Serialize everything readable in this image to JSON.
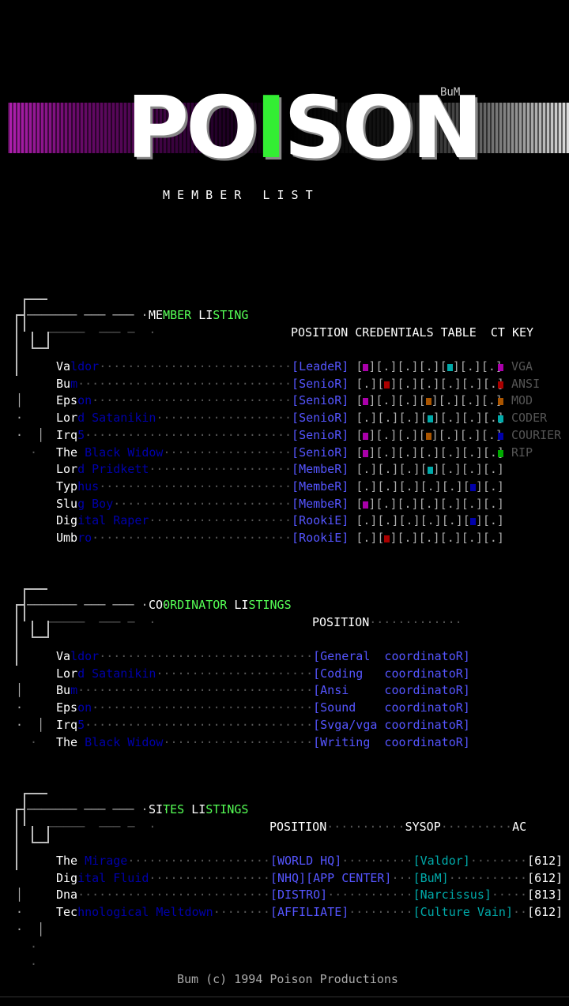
{
  "logo": {
    "part1": "PO",
    "accent": "I",
    "part2": "SON",
    "tag": "BuM"
  },
  "subtitle": "M E M B E R   L I S T",
  "members": {
    "heading_a": "ME",
    "heading_b": "MBER ",
    "heading_c": "LI",
    "heading_d": "STING",
    "col_header": "POSITION CREDENTIALS TABLE  CT KEY",
    "rows": [
      {
        "a": "Va",
        "b": "ldor",
        "pos": "LeadeR",
        "creds": [
          "pu",
          "",
          "",
          "",
          "cyb",
          "",
          ""
        ]
      },
      {
        "a": "Bu",
        "b": "m",
        "pos": "SenioR",
        "creds": [
          "",
          "rd",
          "",
          "",
          "",
          "",
          ""
        ]
      },
      {
        "a": "Eps",
        "b": "on",
        "pos": "SenioR",
        "creds": [
          "pu",
          "",
          "",
          "or",
          "",
          "",
          ""
        ]
      },
      {
        "a": "Lor",
        "b": "d Satanikin",
        "pos": "SenioR",
        "creds": [
          "",
          "",
          "",
          "cyb",
          "",
          "",
          ""
        ]
      },
      {
        "a": "Irq",
        "b": "5",
        "pos": "SenioR",
        "creds": [
          "pu",
          "",
          "",
          "or",
          "",
          "",
          ""
        ]
      },
      {
        "a": "The",
        "b": " Black Widow",
        "pos": "SenioR",
        "creds": [
          "pu",
          "",
          "",
          "",
          "",
          "",
          ""
        ]
      },
      {
        "a": "Lor",
        "b": "d Pridkett",
        "pos": "MembeR",
        "creds": [
          "",
          "",
          "",
          "cyb",
          "",
          "",
          ""
        ]
      },
      {
        "a": "Typ",
        "b": "hus",
        "pos": "MembeR",
        "creds": [
          "",
          "",
          "",
          "",
          "",
          "blb",
          ""
        ]
      },
      {
        "a": "Slu",
        "b": "g Boy",
        "pos": "MembeR",
        "creds": [
          "pu",
          "",
          "",
          "",
          "",
          "",
          ""
        ]
      },
      {
        "a": "Dig",
        "b": "ital Raper",
        "pos": "RookiE",
        "creds": [
          "",
          "",
          "",
          "",
          "",
          "blb",
          ""
        ]
      },
      {
        "a": "Umb",
        "b": "ro",
        "pos": "RookiE",
        "creds": [
          "",
          "rd",
          "",
          "",
          "",
          "",
          ""
        ]
      }
    ],
    "key": [
      {
        "sw": "pu",
        "label": "VGA"
      },
      {
        "sw": "rd",
        "label": "ANSI"
      },
      {
        "sw": "or",
        "label": "MOD"
      },
      {
        "sw": "cyb",
        "label": "CODER"
      },
      {
        "sw": "blb",
        "label": "COURIER"
      },
      {
        "sw": "gnb",
        "label": "RIP"
      }
    ]
  },
  "coordinators": {
    "heading_a": "CO",
    "heading_b": "ORDINATOR ",
    "heading_c": "LI",
    "heading_d": "STINGS",
    "col_header": "POSITION",
    "rows": [
      {
        "a": "Va",
        "b": "ldor",
        "pos": "[General  coordinatoR]"
      },
      {
        "a": "Lor",
        "b": "d Satanikin",
        "pos": "[Coding   coordinatoR]"
      },
      {
        "a": "Bu",
        "b": "m",
        "pos": "[Ansi     coordinatoR]"
      },
      {
        "a": "Eps",
        "b": "on",
        "pos": "[Sound    coordinatoR]"
      },
      {
        "a": "Irq",
        "b": "5",
        "pos": "[Svga/vga coordinatoR]"
      },
      {
        "a": "The",
        "b": " Black Widow",
        "pos": "[Writing  coordinatoR]"
      }
    ]
  },
  "sites": {
    "heading_a": "SI",
    "heading_b": "TES ",
    "heading_c": "LI",
    "heading_d": "STINGS",
    "col_position": "POSITION",
    "col_sysop": "SYSOP",
    "col_ac": "AC",
    "rows": [
      {
        "a": "The",
        "b": " Mirage",
        "pos": "[WORLD HQ]",
        "sysop": "[Valdor]",
        "ac": "[612]"
      },
      {
        "a": "Dig",
        "b": "ital Fluid",
        "pos": "[NHQ][APP CENTER]",
        "sysop": "[BuM]",
        "ac": "[612]"
      },
      {
        "a": "Dna",
        "b": "",
        "pos": "[DISTRO]",
        "sysop": "[Narcissus]",
        "ac": "[813]"
      },
      {
        "a": "Tec",
        "b": "hnological Meltdown",
        "pos": "[AFFILIATE]",
        "sysop": "[Culture Vain]",
        "ac": "[612]"
      }
    ]
  },
  "footer": "Bum (c) 1994 Poison Productions"
}
